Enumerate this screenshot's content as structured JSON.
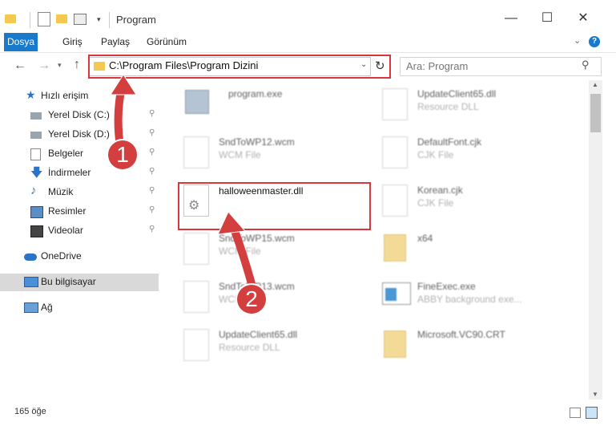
{
  "window": {
    "title": "Program"
  },
  "ribbon": {
    "tabs": [
      "Dosya",
      "Giriş",
      "Paylaş",
      "Görünüm"
    ]
  },
  "address": {
    "path": "C:\\Program Files\\Program Dizini"
  },
  "search": {
    "placeholder": "Ara: Program"
  },
  "nav": {
    "items": [
      {
        "label": "Hızlı erişim",
        "icon": "star-icon"
      },
      {
        "label": "Yerel Disk (C:)",
        "icon": "drive-icon",
        "pinned": true
      },
      {
        "label": "Yerel Disk (D:)",
        "icon": "drive-icon",
        "pinned": true
      },
      {
        "label": "Belgeler",
        "icon": "documents-icon",
        "pinned": true
      },
      {
        "label": "İndirmeler",
        "icon": "download-icon",
        "pinned": true
      },
      {
        "label": "Müzik",
        "icon": "music-icon",
        "pinned": true
      },
      {
        "label": "Resimler",
        "icon": "pictures-icon",
        "pinned": true
      },
      {
        "label": "Videolar",
        "icon": "videos-icon",
        "pinned": true
      },
      {
        "label": "OneDrive",
        "icon": "cloud-icon"
      },
      {
        "label": "Bu bilgisayar",
        "icon": "computer-icon",
        "selected": true
      },
      {
        "label": "Ağ",
        "icon": "network-icon"
      }
    ]
  },
  "files": [
    {
      "name": "program.exe",
      "type": ""
    },
    {
      "name": "UpdateClient65.dll",
      "type": "Resource DLL"
    },
    {
      "name": "SndToWP12.wcm",
      "type": "WCM File"
    },
    {
      "name": "DefaultFont.cjk",
      "type": "CJK File"
    },
    {
      "name": "halloweenmaster.dll",
      "type": ""
    },
    {
      "name": "Korean.cjk",
      "type": "CJK File"
    },
    {
      "name": "SndToWP15.wcm",
      "type": "WCM File"
    },
    {
      "name": "x64",
      "type": ""
    },
    {
      "name": "SndToWP13.wcm",
      "type": "WCM File"
    },
    {
      "name": "FineExec.exe",
      "type": "ABBY background exe..."
    },
    {
      "name": "UpdateClient65.dll",
      "type": "Resource DLL"
    },
    {
      "name": "Microsoft.VC90.CRT",
      "type": ""
    }
  ],
  "status": {
    "count": "165 öğe"
  },
  "callouts": [
    "1",
    "2"
  ],
  "colors": {
    "accent": "#1979ca",
    "highlight": "#d9373d",
    "selected": "#d9d9d9"
  }
}
